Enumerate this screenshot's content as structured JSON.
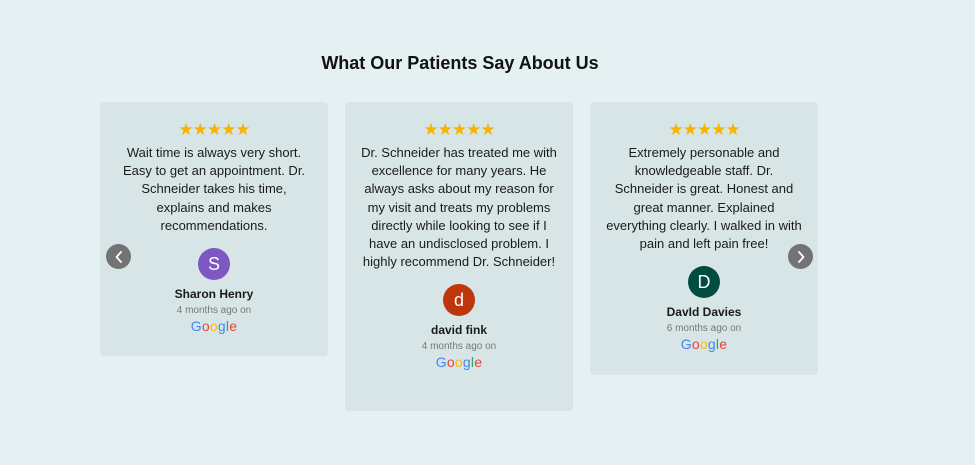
{
  "section": {
    "title": "What Our Patients Say About Us"
  },
  "navigation": {
    "prev_icon": "chevron-left-icon",
    "next_icon": "chevron-right-icon"
  },
  "colors": {
    "background": "#e4f0f2",
    "card": "#d8e5e7",
    "star": "#f6b400",
    "arrow": "#737373"
  },
  "reviews": [
    {
      "rating": 5,
      "stars": "★★★★★",
      "text": "Wait time is always very short. Easy to get an appointment. Dr. Schneider takes his time, explains and makes recommendations.",
      "avatar_letter": "S",
      "avatar_color": "#7e57c2",
      "name": "Sharon Henry",
      "time": "4 months ago on",
      "source": "Google"
    },
    {
      "rating": 5,
      "stars": "★★★★★",
      "text": "Dr. Schneider has treated me with excellence for many years. He always asks about my reason for my visit and treats my problems directly while looking to see if I have an undisclosed problem. I highly recommend Dr. Schneider!",
      "avatar_letter": "d",
      "avatar_color": "#bf360c",
      "name": "david fink",
      "time": "4 months ago on",
      "source": "Google"
    },
    {
      "rating": 5,
      "stars": "★★★★★",
      "text": "Extremely personable and knowledgeable staff. Dr. Schneider is great. Honest and great manner. Explained everything clearly. I walked in with pain and left pain free!",
      "avatar_letter": "D",
      "avatar_color": "#004d40",
      "name": "DavId Davies",
      "time": "6 months ago on",
      "source": "Google"
    }
  ]
}
